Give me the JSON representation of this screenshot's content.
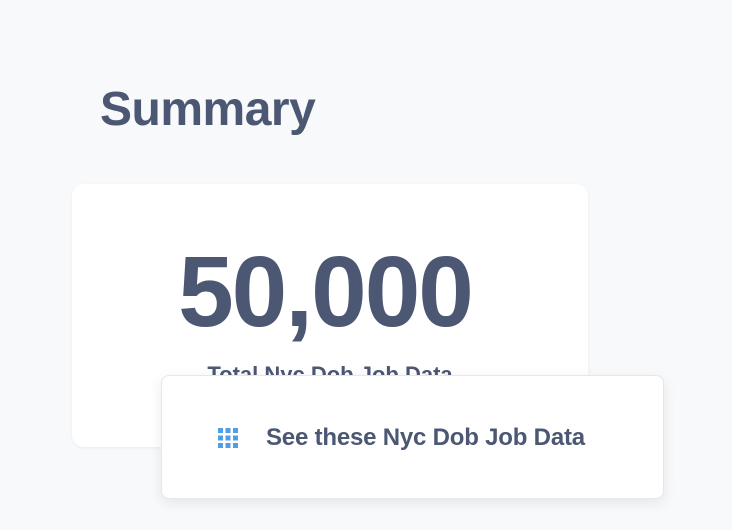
{
  "section": {
    "title": "Summary"
  },
  "scalar": {
    "value": "50,000",
    "label": "Total Nyc Dob Job Data"
  },
  "popover": {
    "action_label": "See these Nyc Dob Job Data",
    "action_icon": "table-grid-icon",
    "icon_color": "#509ee3"
  }
}
